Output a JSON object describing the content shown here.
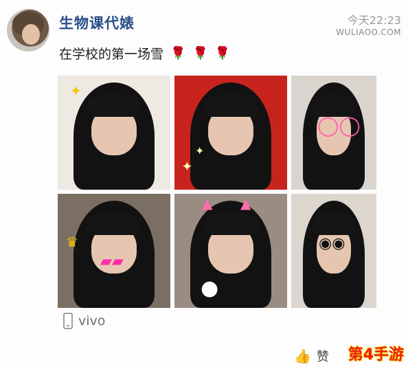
{
  "header": {
    "username": "生物课代婊",
    "timestamp": "今天22:23",
    "watermark": "WULIAOO.COM"
  },
  "post": {
    "text": "在学校的第一场雪",
    "emoji": [
      "rose-icon",
      "rose-icon",
      "rose-icon"
    ]
  },
  "photos": [
    {
      "name": "photo-1",
      "bg": "#efe9e4"
    },
    {
      "name": "photo-2",
      "bg": "#c8231d"
    },
    {
      "name": "photo-3",
      "bg": "#d9d4ce"
    },
    {
      "name": "photo-4",
      "bg": "#7b6f63"
    },
    {
      "name": "photo-5",
      "bg": "#9a8c82"
    },
    {
      "name": "photo-6",
      "bg": "#dcd6cf"
    }
  ],
  "footer": {
    "device": "vivo",
    "like_label": "赞"
  },
  "corner_logo": "第4手游",
  "colors": {
    "username": "#2a4f87",
    "like_icon": "#3a6bb3",
    "logo": "#e8211b"
  }
}
